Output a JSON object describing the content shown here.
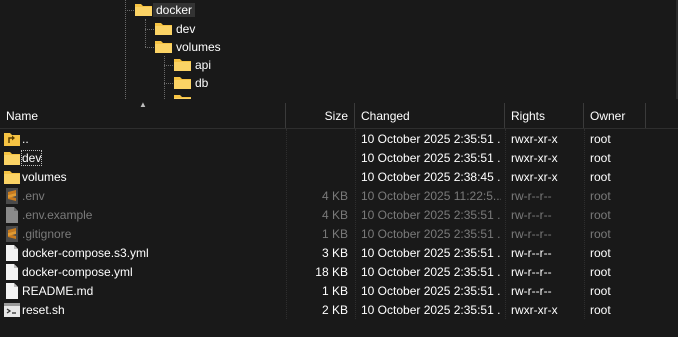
{
  "tree": {
    "nodes": [
      {
        "label": "docker",
        "selected": true
      },
      {
        "label": "dev"
      },
      {
        "label": "volumes"
      },
      {
        "label": "api"
      },
      {
        "label": "db"
      }
    ]
  },
  "columns": {
    "name": "Name",
    "size": "Size",
    "changed": "Changed",
    "rights": "Rights",
    "owner": "Owner"
  },
  "files": [
    {
      "name": "..",
      "size": "",
      "changed": "10 October 2025 2:35:51 ...",
      "rights": "rwxr-xr-x",
      "owner": "root",
      "icon": "folder-up-icon",
      "hidden": false
    },
    {
      "name": "dev",
      "size": "",
      "changed": "10 October 2025 2:35:51 ...",
      "rights": "rwxr-xr-x",
      "owner": "root",
      "icon": "folder-icon",
      "hidden": false
    },
    {
      "name": "volumes",
      "size": "",
      "changed": "10 October 2025 2:38:45 ...",
      "rights": "rwxr-xr-x",
      "owner": "root",
      "icon": "folder-icon",
      "hidden": false
    },
    {
      "name": ".env",
      "size": "4 KB",
      "changed": "10 October 2025 11:22:5...",
      "rights": "rw-r--r--",
      "owner": "root",
      "icon": "sublime-file-icon",
      "hidden": true
    },
    {
      "name": ".env.example",
      "size": "4 KB",
      "changed": "10 October 2025 2:35:51 ...",
      "rights": "rw-r--r--",
      "owner": "root",
      "icon": "file-icon",
      "hidden": true
    },
    {
      "name": ".gitignore",
      "size": "1 KB",
      "changed": "10 October 2025 2:35:51 ...",
      "rights": "rw-r--r--",
      "owner": "root",
      "icon": "sublime-file-icon",
      "hidden": true
    },
    {
      "name": "docker-compose.s3.yml",
      "size": "3 KB",
      "changed": "10 October 2025 2:35:51 ...",
      "rights": "rw-r--r--",
      "owner": "root",
      "icon": "file-icon",
      "hidden": false
    },
    {
      "name": "docker-compose.yml",
      "size": "18 KB",
      "changed": "10 October 2025 2:35:51 ...",
      "rights": "rw-r--r--",
      "owner": "root",
      "icon": "file-icon",
      "hidden": false
    },
    {
      "name": "README.md",
      "size": "1 KB",
      "changed": "10 October 2025 2:35:51 ...",
      "rights": "rw-r--r--",
      "owner": "root",
      "icon": "file-icon",
      "hidden": false
    },
    {
      "name": "reset.sh",
      "size": "2 KB",
      "changed": "10 October 2025 2:35:51 ...",
      "rights": "rwxr-xr-x",
      "owner": "root",
      "icon": "script-file-icon",
      "hidden": false
    }
  ],
  "colors": {
    "background": "#191919",
    "folder": "#f6c343",
    "hidden_text": "#7a7a7a"
  }
}
